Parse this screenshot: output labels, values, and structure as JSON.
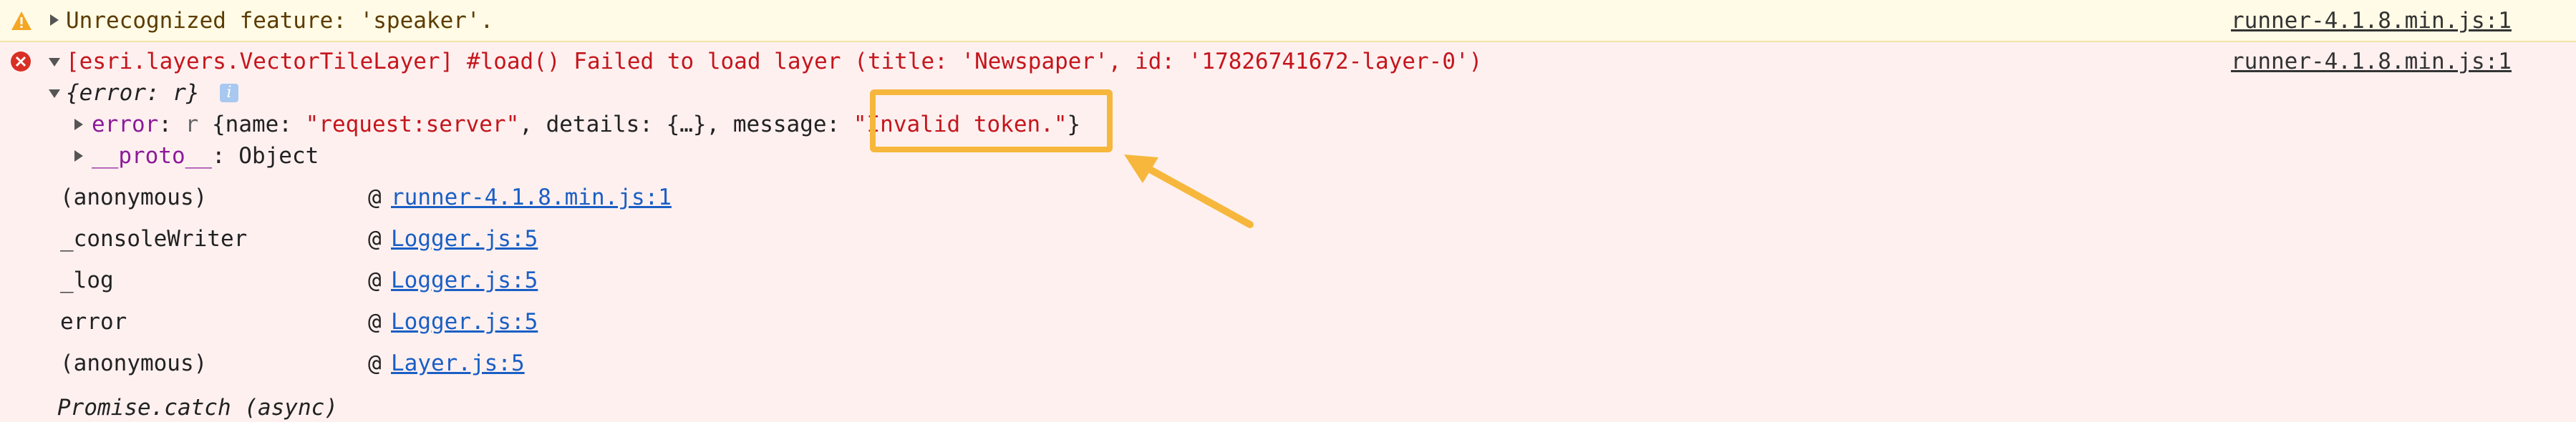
{
  "warning": {
    "icon": "warning-triangle-icon",
    "message": "Unrecognized feature: 'speaker'.",
    "source": "runner-4.1.8.min.js:1",
    "color": "#f5a623"
  },
  "error": {
    "icon": "error-circle-icon",
    "message": "[esri.layers.VectorTileLayer] #load() Failed to load layer (title: 'Newspaper', id: '17826741672-layer-0')",
    "source": "runner-4.1.8.min.js:1",
    "color": "#d93025"
  },
  "object_tree": {
    "root": "{error: r}",
    "info_badge": "i",
    "error_line": {
      "key": "error",
      "sep": ": ",
      "type": "r",
      "open": " {name: ",
      "name_val": "\"request:server\"",
      "details": ", details: {…}, message: ",
      "message_val": "\"Invalid token.\"",
      "close": "}"
    },
    "proto_line": {
      "key": "__proto__",
      "value": ": Object"
    }
  },
  "stack": [
    {
      "fn": "(anonymous)",
      "at": "@",
      "link": "runner-4.1.8.min.js:1"
    },
    {
      "fn": "_consoleWriter",
      "at": "@",
      "link": "Logger.js:5"
    },
    {
      "fn": "_log",
      "at": "@",
      "link": "Logger.js:5"
    },
    {
      "fn": "error",
      "at": "@",
      "link": "Logger.js:5"
    },
    {
      "fn": "(anonymous)",
      "at": "@",
      "link": "Layer.js:5"
    }
  ],
  "async_label": "Promise.catch (async)",
  "annotation_color": "#f6b73c"
}
